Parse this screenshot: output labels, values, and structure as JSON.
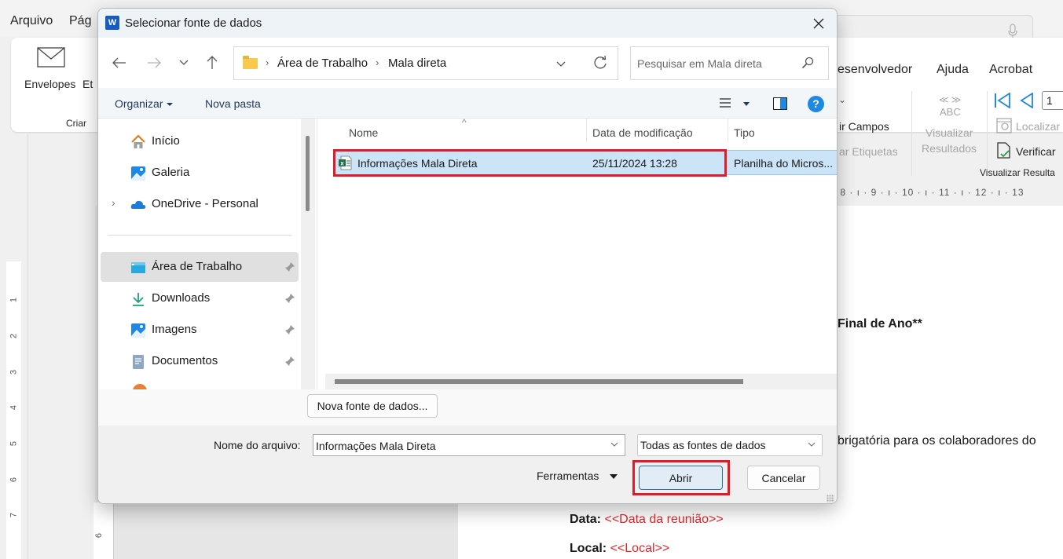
{
  "word": {
    "menu": [
      {
        "label": "Arquivo"
      },
      {
        "label": "Pág"
      }
    ],
    "tabs_right": [
      {
        "label": "esenvolvedor"
      },
      {
        "label": "Ajuda"
      },
      {
        "label": "Acrobat"
      }
    ],
    "ribbon": {
      "envelopes": "Envelopes",
      "etiquetas_partial": "Et",
      "group_criar": "Criar",
      "inserir_campos": "ir Campos",
      "atualizar_etiquetas": "ar Etiquetas",
      "abc": "ABC",
      "visualizar": "Visualizar",
      "resultados": "Resultados",
      "localizar": "Localizar",
      "verificar": "Verificar",
      "group_visualizar": "Visualizar Resulta",
      "record_number": "1"
    },
    "ruler_top": "· 8 · ı · 9 · ı · 10 · ı · 11 · ı · 12 · ı · 13",
    "ruler_left": [
      "1",
      "2",
      "3",
      "4",
      "5",
      "6",
      "7"
    ],
    "ruler_lower": "6",
    "document": {
      "heading_partial": "Final de Ano**",
      "body_partial": "brigatória para os colaboradores do",
      "data_label": "Data:",
      "data_field": "<<Data da reunião>>",
      "local_label": "Local:",
      "local_field": "<<Local>>"
    }
  },
  "dialog": {
    "title": "Selecionar fonte de dados",
    "app_icon_letter": "W",
    "breadcrumb": [
      {
        "label": "Área de Trabalho"
      },
      {
        "label": "Mala direta"
      }
    ],
    "search_placeholder": "Pesquisar em Mala direta",
    "commands": {
      "organize": "Organizar",
      "new_folder": "Nova pasta"
    },
    "nav_items": [
      {
        "label": "Início",
        "icon": "home-icon",
        "pinned": false
      },
      {
        "label": "Galeria",
        "icon": "gallery-icon",
        "pinned": false
      },
      {
        "label": "OneDrive - Personal",
        "icon": "onedrive-icon",
        "pinned": false,
        "expandable": true
      },
      {
        "label": "Área de Trabalho",
        "icon": "desktop-icon",
        "pinned": true,
        "selected": true
      },
      {
        "label": "Downloads",
        "icon": "download-icon",
        "pinned": true
      },
      {
        "label": "Imagens",
        "icon": "pictures-icon",
        "pinned": true
      },
      {
        "label": "Documentos",
        "icon": "documents-icon",
        "pinned": true
      }
    ],
    "columns": {
      "name": "Nome",
      "date": "Data de modificação",
      "type": "Tipo"
    },
    "files": [
      {
        "name": "Informações Mala Direta",
        "date": "25/11/2024 13:28",
        "type": "Planilha do Micros...",
        "icon": "excel-file-icon",
        "selected": true
      }
    ],
    "new_source_button": "Nova fonte de dados...",
    "filename_label": "Nome do arquivo:",
    "filename_value": "Informações Mala Direta",
    "filetype_value": "Todas as fontes de dados",
    "tools_label": "Ferramentas",
    "open_button": "Abrir",
    "cancel_button": "Cancelar",
    "highlight_color": "#e21b26"
  }
}
